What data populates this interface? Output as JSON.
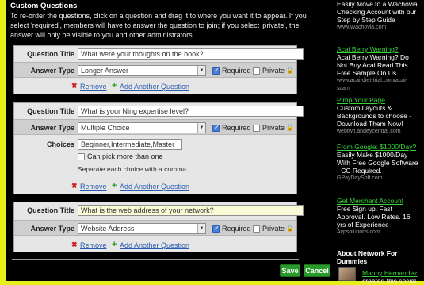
{
  "section_title": "Custom Questions",
  "intro": "To re-order the questions, click on a question and drag it to where you want it to appear. If you select 'required', members will have to answer the question to join; if you select 'private', the answer will only be visible to you and other administrators.",
  "labels": {
    "question_title": "Question Title",
    "answer_type": "Answer Type",
    "choices": "Choices",
    "required": "Required",
    "private": "Private",
    "remove": "Remove",
    "add_another": "Add Another Question",
    "pick_more": "Can pick more than one",
    "separate_hint": "Separate each choice with a comma"
  },
  "questions": [
    {
      "title": "What were your thoughts on the book?",
      "answer_type": "Longer Answer",
      "required": true,
      "private": false
    },
    {
      "title": "What is your Ning expertise level?",
      "answer_type": "Multiple Choice",
      "required": true,
      "private": false,
      "choices": "Beginner,Intermediate,Master",
      "pick_more": false
    },
    {
      "title": "What is the web address of your network?",
      "answer_type": "Website Address",
      "required": true,
      "private": false
    }
  ],
  "buttons": {
    "save": "Save",
    "cancel": "Cancel"
  },
  "ads": [
    {
      "title": "",
      "body": "Easily Move to a Wachovia Checking Account with our Step by Step Guide",
      "url": "www.Wachovia.com"
    },
    {
      "title": "Acai Berry Warning?",
      "body": "Acai Berry Warning? Do Not Buy Acai Read This. Free Sample On Us.",
      "url": "www.acai-diet-trial.com/acai-scam"
    },
    {
      "title": "Pimp Your Page",
      "body": "Custom Layouts & Backgrounds to choose - Download Them Now!",
      "url": "webtwit.andeycentral.com"
    },
    {
      "title": "From Google: $1000/Day?",
      "body": "Easily Make $1000/Day With Free Google Software - CC Required.",
      "url": "GPayDaySoft.com"
    },
    {
      "title": "Get Merchant Account",
      "body": "Free Sign up. Fast Approval. Low Rates. 16 yrs of Experience",
      "url": "Avpsolutions.com"
    }
  ],
  "about": {
    "title": "About Network For Dummies",
    "user": "Manny Hernandez",
    "text": "created this social"
  }
}
